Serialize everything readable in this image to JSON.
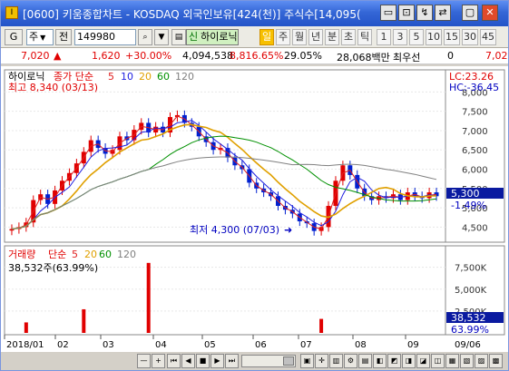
{
  "window": {
    "title": "[0600] 키움종합차트 - KOSDAQ 외국인보유[424(천)] 주식수[14,095(",
    "app_icon": "I",
    "buttons": [
      "▭",
      "⊡",
      "↯",
      "⇄",
      "▢",
      "✕"
    ]
  },
  "toolbar": {
    "stock_icon_label": "G",
    "market": "주",
    "prev_label": "전",
    "code": "149980",
    "name": "하이로닉",
    "sin_label": "신",
    "periods": [
      "일",
      "주",
      "월",
      "년",
      "분",
      "초",
      "틱"
    ],
    "active_period": "일",
    "numbers": [
      "1",
      "3",
      "5",
      "10",
      "15",
      "30",
      "45"
    ]
  },
  "quote": {
    "price": "7,020",
    "change": "1,620",
    "change_pct": "+30.00%",
    "volume": "4,094,538",
    "volume_pct": "8,816.65%",
    "turnover": "29.05%",
    "amount": "28,068백만",
    "pref_label": "최우선",
    "pref_value": "0",
    "right_price": "7,02"
  },
  "price_panel": {
    "name": "하이로닉",
    "ma_label": "종가 단순",
    "ma_periods": [
      "5",
      "10",
      "20",
      "60",
      "120"
    ],
    "ma_colors": [
      "#e02020",
      "#2020e0",
      "#e0a000",
      "#009000",
      "#808080"
    ],
    "high_note": "최고 8,340 (03/13)",
    "low_note": "최저 4,300 (07/03)",
    "lc": "LC:23.26",
    "hc": "HC:-36.45",
    "current": "5,300",
    "current_pct": "-1.49%",
    "y_ticks": [
      "8,000",
      "7,500",
      "7,000",
      "6,500",
      "6,000",
      "5,500",
      "5,000",
      "4,500"
    ]
  },
  "volume_panel": {
    "label": "거래량",
    "ma_label": "단순",
    "ma_periods": [
      "5",
      "20",
      "60",
      "120"
    ],
    "current": "38,532주(63.99%)",
    "right_value": "38,532",
    "right_pct": "63.99%",
    "y_ticks": [
      "7,500K",
      "5,000K",
      "2,500K"
    ]
  },
  "x_axis": {
    "labels": [
      "2018/01",
      "02",
      "03",
      "04",
      "05",
      "06",
      "07",
      "08",
      "09"
    ],
    "right_label": "09/06"
  },
  "chart_data": {
    "type": "candlestick",
    "price_series_close": [
      4450,
      4500,
      4620,
      5200,
      5350,
      5100,
      5450,
      5700,
      5900,
      6150,
      6450,
      6750,
      6550,
      6400,
      6500,
      6850,
      6750,
      7020,
      7200,
      6950,
      7100,
      6950,
      7350,
      7400,
      7200,
      7100,
      6850,
      6700,
      6500,
      6550,
      6300,
      6100,
      6000,
      5650,
      5500,
      5400,
      5300,
      5050,
      4950,
      4850,
      4650,
      4600,
      4400,
      4500,
      5050,
      5700,
      6100,
      5850,
      5500,
      5300,
      5200,
      5300,
      5250,
      5350,
      5200,
      5400,
      5300,
      5250,
      5400,
      5300
    ],
    "price_range": [
      4250,
      8150
    ],
    "volume_peaks_k": [
      {
        "month": "03",
        "value": 8000
      },
      {
        "month": "02",
        "value": 2700
      },
      {
        "month": "07",
        "value": 1600
      },
      {
        "month": "01",
        "value": 1200
      }
    ],
    "volume_range_k": [
      0,
      8500
    ]
  }
}
